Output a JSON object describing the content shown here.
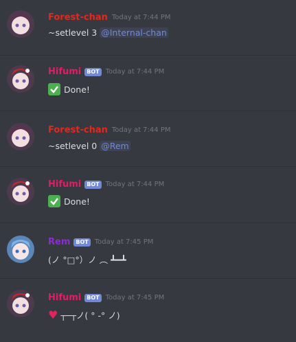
{
  "colors": {
    "forest": "#e0291f",
    "hifumi": "#e31c64",
    "rem": "#8e2bd8",
    "mention": "#7289da",
    "bot_badge": "#7289da"
  },
  "messages": [
    {
      "author": "Forest-chan",
      "timestamp": "Today at 7:44 PM",
      "text": "~setlevel 3",
      "mention": "@Internal-chan"
    },
    {
      "author": "Hifumi",
      "bot_badge": "BOT",
      "timestamp": "Today at 7:44 PM",
      "icon": "check-mark-icon",
      "text": "Done!"
    },
    {
      "author": "Forest-chan",
      "timestamp": "Today at 7:44 PM",
      "text": "~setlevel 0",
      "mention": "@Rem"
    },
    {
      "author": "Hifumi",
      "bot_badge": "BOT",
      "timestamp": "Today at 7:44 PM",
      "icon": "check-mark-icon",
      "text": "Done!"
    },
    {
      "author": "Rem",
      "bot_badge": "BOT",
      "timestamp": "Today at 7:45 PM",
      "text": "(ノ °□°）ノ ︵ ┻━┻"
    },
    {
      "author": "Hifumi",
      "bot_badge": "BOT",
      "timestamp": "Today at 7:45 PM",
      "icon": "heart-icon",
      "text": "┬─┬ノ( ° -° ノ)"
    }
  ]
}
